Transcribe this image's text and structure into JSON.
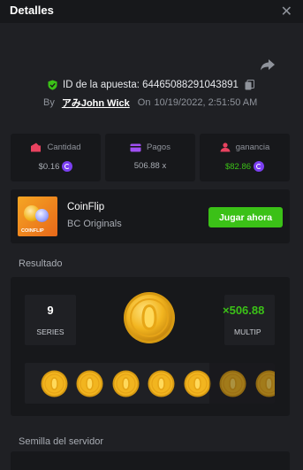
{
  "header": {
    "title": "Detalles",
    "close_label": "✕"
  },
  "bet": {
    "id_label": "ID de la apuesta:",
    "id_value": "64465088291043891",
    "by_label": "By",
    "username": "アみJohn Wick",
    "on_label": "On",
    "timestamp": "10/19/2022, 2:51:50 AM"
  },
  "stats": {
    "amount": {
      "label": "Cantidad",
      "value": "$0.16",
      "icon": "wallet-icon",
      "color": "#e8425f"
    },
    "payout": {
      "label": "Pagos",
      "value": "506.88 x",
      "icon": "card-icon",
      "color": "#a04ff2"
    },
    "profit": {
      "label": "ganancia",
      "value": "$82.86",
      "icon": "person-icon",
      "color": "#e8425f",
      "value_color": "#3bc117"
    }
  },
  "game": {
    "name": "CoinFlip",
    "provider": "BC Originals",
    "thumb_text": "COINFLIP",
    "play_label": "Jugar ahora"
  },
  "result": {
    "title": "Resultado",
    "series_value": "9",
    "series_label": "SERIES",
    "multiplier_value": "×506.88",
    "multiplier_label": "MULTIP"
  },
  "seed": {
    "title": "Semilla del servidor"
  },
  "colors": {
    "background": "#1f2024",
    "panel": "#17181b",
    "accent_green": "#3bc117",
    "coin_gold": "#f2b51f",
    "brand_purple": "#7b3ff2"
  }
}
